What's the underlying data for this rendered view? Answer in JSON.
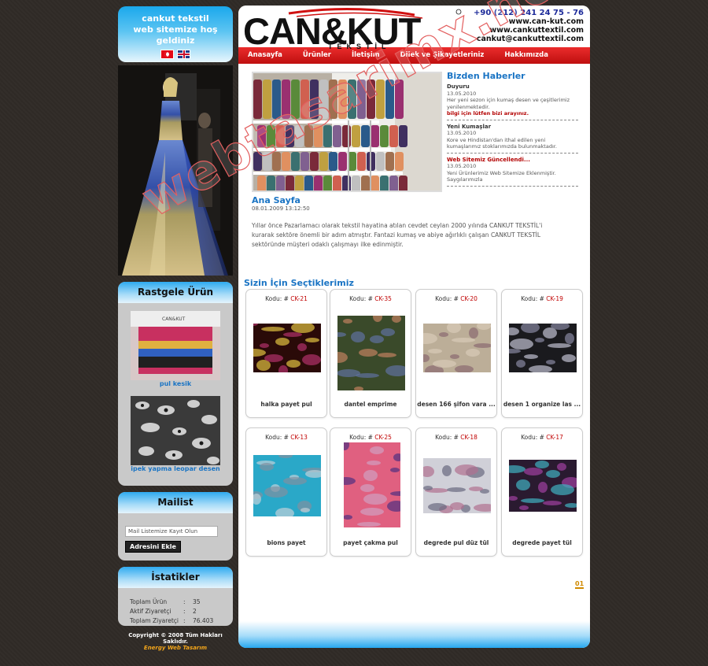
{
  "welcome": {
    "line1": "cankut tekstil",
    "line2": "web sitemize hoş geldiniz"
  },
  "random_product": {
    "title": "Rastgele Ürün",
    "items": [
      {
        "label": "pul kesik"
      },
      {
        "label": "ipek yapma leopar desen"
      }
    ]
  },
  "maillist": {
    "title": "Mailist",
    "placeholder": "Mail Listemize Kayıt Olun",
    "button": "Adresini Ekle"
  },
  "stats": {
    "title": "İstatikler",
    "rows": [
      {
        "label": "Toplam Ürün",
        "sep": ":",
        "value": "35"
      },
      {
        "label": "Aktif Ziyaretçi",
        "sep": ":",
        "value": "2"
      },
      {
        "label": "Toplam Ziyaretçi",
        "sep": ":",
        "value": "76.403"
      }
    ]
  },
  "copyright": {
    "text": "Copyright © 2008 Tüm Hakları Saklıdır.",
    "credit": "Energy Web Tasarım"
  },
  "header": {
    "logo_text": "CAN&KUT",
    "logo_sub": "TEKSTİL",
    "phone": "+90 (212) 241 24 75 - 76",
    "web1": "www.can-kut.com",
    "web2": "www.cankuttextil.com",
    "email": "cankut@cankuttextil.com"
  },
  "nav": [
    "Anasayfa",
    "Ürünler",
    "İletişim",
    "Dilek ve Şikayetleriniz",
    "Hakkımızda"
  ],
  "news": {
    "title": "Bizden Haberler",
    "items": [
      {
        "heading": "Duyuru",
        "date": "13.05.2010",
        "text": "Her yeni sezon için kumaş desen ve çeşitlerimiz yenilenmektedir.",
        "link": "bilgi için lütfen bizi arayınız."
      },
      {
        "heading": "Yeni Kumaşlar",
        "date": "13.05.2010",
        "text": "Kore ve Hindistan'dan ithal edilen yeni kumaşlarımız stoklarımızda bulunmaktadır.",
        "link": ""
      },
      {
        "heading": "Web Sitemiz Güncellendi...",
        "date": "13.05.2010",
        "text": "Yeni Ürünlerimiz Web Sitemize Eklenmiştir. Saygılarımızla",
        "link": ""
      }
    ]
  },
  "ana_sayfa": {
    "title": "Ana Sayfa",
    "date": "08.01.2009 13:12:50",
    "text": "Yıllar önce Pazarlamacı olarak tekstil hayatina atılan cevdet ceylan 2000 yılında CANKUT TEKSTİL'i kurarak sektöre önemli bir adım atmıştır. Fantazi kumaş ve abiye ağırlıklı çalışan CANKUT TEKSTİL sektöründe müşteri odaklı çalışmayı ilke edinmiştir."
  },
  "picks": {
    "title": "Sizin İçin Seçtiklerimiz",
    "code_prefix": "Kodu: #",
    "products": [
      {
        "code": "CK-21",
        "name": "halka payet pul",
        "colors": [
          "#2a0a08",
          "#b0306a",
          "#e0c040"
        ]
      },
      {
        "code": "CK-35",
        "name": "dantel emprime",
        "colors": [
          "#3a4a2a",
          "#c08060",
          "#6070a0"
        ]
      },
      {
        "code": "CK-20",
        "name": "desen 166 şifon vara ...",
        "colors": [
          "#bcae98",
          "#8a6a70",
          "#d8cbb8"
        ]
      },
      {
        "code": "CK-19",
        "name": "desen 1 organize las ...",
        "colors": [
          "#1a1a1e",
          "#8888a0",
          "#c0c0d0"
        ]
      },
      {
        "code": "CK-13",
        "name": "bions payet",
        "colors": [
          "#2aa8c8",
          "#c0d0d8",
          "#8090a0"
        ]
      },
      {
        "code": "CK-25",
        "name": "payet çakma pul",
        "colors": [
          "#e06080",
          "#503080",
          "#d0a0c0"
        ]
      },
      {
        "code": "CK-18",
        "name": "degrede pul düz tül",
        "colors": [
          "#d0d0d8",
          "#6a6a80",
          "#b07090"
        ]
      },
      {
        "code": "CK-17",
        "name": "degrede payet tül",
        "colors": [
          "#2a1a30",
          "#a040a0",
          "#40b0c0"
        ]
      }
    ]
  },
  "pager": {
    "current": "01"
  },
  "watermark": "webtasarimx.net"
}
